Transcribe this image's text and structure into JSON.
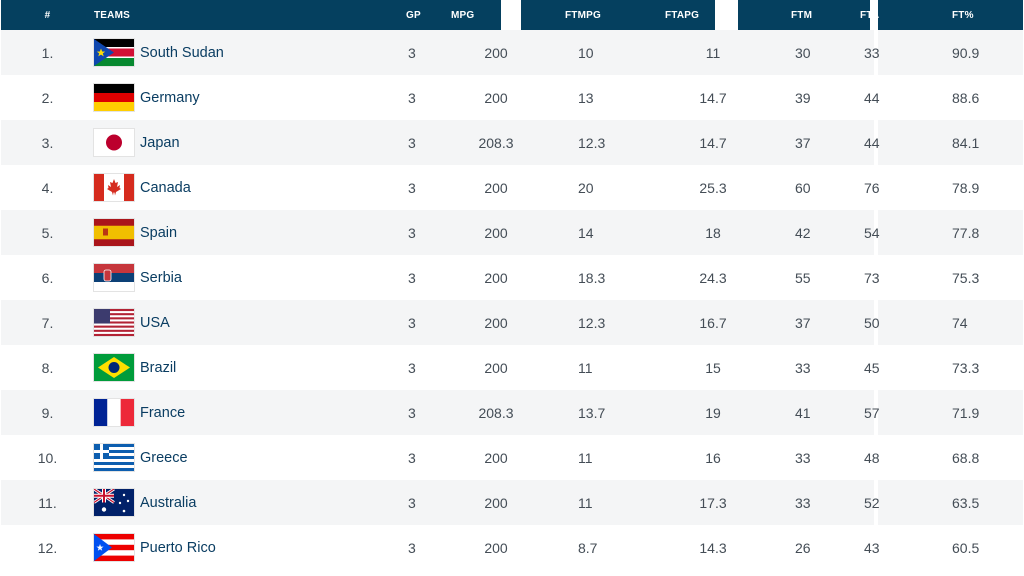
{
  "columns": {
    "rank": "#",
    "teams": "TEAMS",
    "gp": "GP",
    "mpg": "MPG",
    "ftmpg": "FTMPG",
    "ftapg": "FTAPG",
    "ftm": "FTM",
    "fta": "FTA",
    "ftpct": "FT%"
  },
  "rows": [
    {
      "rank": "1.",
      "team": "South Sudan",
      "flag": "south-sudan",
      "gp": "3",
      "mpg": "200",
      "ftmpg": "10",
      "ftapg": "11",
      "ftm": "30",
      "fta": "33",
      "ftpct": "90.9"
    },
    {
      "rank": "2.",
      "team": "Germany",
      "flag": "germany",
      "gp": "3",
      "mpg": "200",
      "ftmpg": "13",
      "ftapg": "14.7",
      "ftm": "39",
      "fta": "44",
      "ftpct": "88.6"
    },
    {
      "rank": "3.",
      "team": "Japan",
      "flag": "japan",
      "gp": "3",
      "mpg": "208.3",
      "ftmpg": "12.3",
      "ftapg": "14.7",
      "ftm": "37",
      "fta": "44",
      "ftpct": "84.1"
    },
    {
      "rank": "4.",
      "team": "Canada",
      "flag": "canada",
      "gp": "3",
      "mpg": "200",
      "ftmpg": "20",
      "ftapg": "25.3",
      "ftm": "60",
      "fta": "76",
      "ftpct": "78.9"
    },
    {
      "rank": "5.",
      "team": "Spain",
      "flag": "spain",
      "gp": "3",
      "mpg": "200",
      "ftmpg": "14",
      "ftapg": "18",
      "ftm": "42",
      "fta": "54",
      "ftpct": "77.8"
    },
    {
      "rank": "6.",
      "team": "Serbia",
      "flag": "serbia",
      "gp": "3",
      "mpg": "200",
      "ftmpg": "18.3",
      "ftapg": "24.3",
      "ftm": "55",
      "fta": "73",
      "ftpct": "75.3"
    },
    {
      "rank": "7.",
      "team": "USA",
      "flag": "usa",
      "gp": "3",
      "mpg": "200",
      "ftmpg": "12.3",
      "ftapg": "16.7",
      "ftm": "37",
      "fta": "50",
      "ftpct": "74"
    },
    {
      "rank": "8.",
      "team": "Brazil",
      "flag": "brazil",
      "gp": "3",
      "mpg": "200",
      "ftmpg": "11",
      "ftapg": "15",
      "ftm": "33",
      "fta": "45",
      "ftpct": "73.3"
    },
    {
      "rank": "9.",
      "team": "France",
      "flag": "france",
      "gp": "3",
      "mpg": "208.3",
      "ftmpg": "13.7",
      "ftapg": "19",
      "ftm": "41",
      "fta": "57",
      "ftpct": "71.9"
    },
    {
      "rank": "10.",
      "team": "Greece",
      "flag": "greece",
      "gp": "3",
      "mpg": "200",
      "ftmpg": "11",
      "ftapg": "16",
      "ftm": "33",
      "fta": "48",
      "ftpct": "68.8"
    },
    {
      "rank": "11.",
      "team": "Australia",
      "flag": "australia",
      "gp": "3",
      "mpg": "200",
      "ftmpg": "11",
      "ftapg": "17.3",
      "ftm": "33",
      "fta": "52",
      "ftpct": "63.5"
    },
    {
      "rank": "12.",
      "team": "Puerto Rico",
      "flag": "puerto-rico",
      "gp": "3",
      "mpg": "200",
      "ftmpg": "8.7",
      "ftapg": "14.3",
      "ftm": "26",
      "fta": "43",
      "ftpct": "60.5"
    }
  ],
  "colors": {
    "header_bg": "#05405f",
    "header_text": "#ffffff",
    "row_alt": "#f4f5f6",
    "team_text": "#0a3d62",
    "cell_text": "#444d56"
  }
}
